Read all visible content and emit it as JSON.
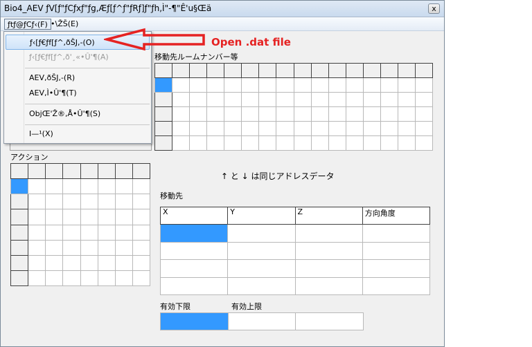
{
  "window": {
    "title": "Bio4_AEV ƒV[ƒ\"ƒCƒxƒ\"ƒg,Æƒ[ƒ^ƒ\"ƒRƒ]ƒ\"ƒh,Ì\"-¶\"Ê'u§Œä",
    "close_label": "x"
  },
  "menubar": {
    "file": "ƒtƒ@ƒCƒ‹(F)",
    "display": "•\\ŽŠ(E)"
  },
  "file_menu": {
    "items": [
      {
        "label": "ƒ‹[ƒ€ƒf[ƒ^,ðŠJ,-(O)",
        "state": "highlighted"
      },
      {
        "label": "ƒ‹[ƒ€ƒf[ƒ^,ð'¸«•Û'¶(A)",
        "state": "disabled"
      },
      {
        "label": "AEV,ðŠJ,-(R)",
        "state": "normal"
      },
      {
        "label": "AEV,Ì•Û'¶(T)",
        "state": "normal"
      },
      {
        "label": "ObjŒ'Ž®,Å•Û'¶(S)",
        "state": "normal"
      },
      {
        "label": "I—¹(X)",
        "state": "normal"
      }
    ]
  },
  "annotation": {
    "text": "Open .dat file",
    "color": "#e52222"
  },
  "labels": {
    "room_number": "移動先ルームナンバー等",
    "action": "アクション",
    "same_address": "↑ と ↓ は同じアドレスデータ",
    "destination": "移動先",
    "valid_lower": "有効下限",
    "valid_upper": "有効上限"
  },
  "destination_table": {
    "columns": [
      "X",
      "Y",
      "Z",
      "方向角度"
    ]
  },
  "colors": {
    "selection": "#3399ff",
    "window_bg": "#f0f0f0"
  }
}
